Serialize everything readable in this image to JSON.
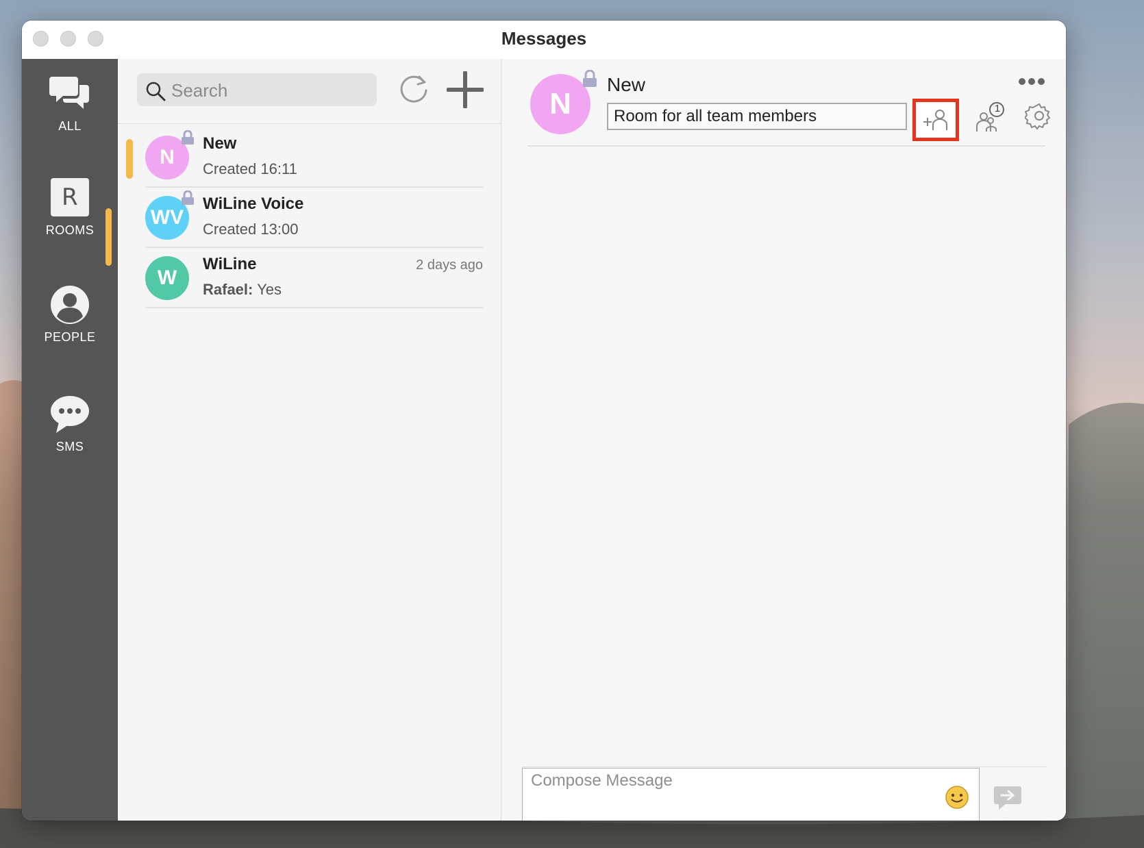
{
  "window": {
    "title": "Messages"
  },
  "nav": {
    "items": [
      {
        "label": "ALL",
        "icon": "chat-bubbles-icon"
      },
      {
        "label": "ROOMS",
        "icon": "rooms-r-icon",
        "letter": "R"
      },
      {
        "label": "PEOPLE",
        "icon": "person-icon"
      },
      {
        "label": "SMS",
        "icon": "sms-bubble-icon"
      }
    ],
    "active": "ROOMS",
    "accent": "#f4b949"
  },
  "search": {
    "placeholder": "Search"
  },
  "rooms": [
    {
      "initials": "N",
      "name": "New",
      "subtitle": "Created 16:11",
      "time": "",
      "color": "#f0a6f0",
      "locked": true,
      "selected": true
    },
    {
      "initials": "WV",
      "name": "WiLine Voice",
      "subtitle": "Created 13:00",
      "time": "",
      "color": "#5fd0f6",
      "locked": true,
      "selected": false
    },
    {
      "initials": "W",
      "name": "WiLine",
      "sender": "Rafael:",
      "subtitle": " Yes",
      "time": "2 days ago",
      "color": "#52c9a6",
      "locked": false,
      "selected": false
    }
  ],
  "chat": {
    "room_initial": "N",
    "room_name": "New",
    "topic": "Room for all team members",
    "members_badge": "1",
    "compose_placeholder": "Compose Message",
    "highlight_color": "#e5341f"
  }
}
